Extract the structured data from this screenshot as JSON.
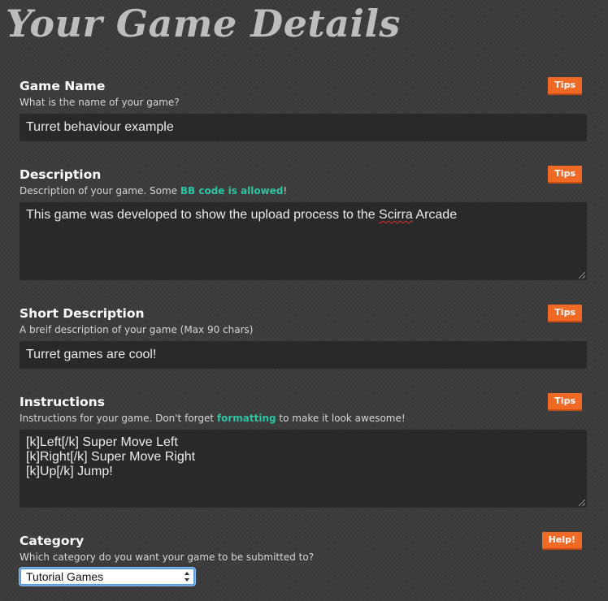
{
  "page": {
    "title": "Your Game Details"
  },
  "sections": {
    "game_name": {
      "title": "Game Name",
      "description": "What is the name of your game?",
      "tips_label": "Tips",
      "value": "Turret behaviour example"
    },
    "description": {
      "title": "Description",
      "description_before": "Description of your game. Some ",
      "description_link": "BB code is allowed",
      "description_after": "!",
      "tips_label": "Tips",
      "value_before": "This game was developed to show the upload process to the ",
      "value_misspelled": "Scirra",
      "value_after": " Arcade"
    },
    "short_description": {
      "title": "Short Description",
      "description": "A breif description of your game (Max 90 chars)",
      "tips_label": "Tips",
      "value": "Turret games are cool!"
    },
    "instructions": {
      "title": "Instructions",
      "description_before": "Instructions for your game. Don't forget ",
      "description_link": "formatting",
      "description_after": " to make it look awesome!",
      "tips_label": "Tips",
      "value": "[k]Left[/k] Super Move Left\n[k]Right[/k] Super Move Right\n[k]Up[/k] Jump!"
    },
    "category": {
      "title": "Category",
      "description": "Which category do you want your game to be submitted to?",
      "help_label": "Help!",
      "selected": "Tutorial Games"
    }
  },
  "colors": {
    "background": "#3c3c3c",
    "title": "#bdbdbd",
    "accent_button": "#f06a26",
    "link": "#2dc5a1",
    "input_bg": "#292929",
    "select_focus": "#5b9ce0"
  },
  "icons": {
    "resize": "resize-grip-icon",
    "select": "select-arrows-icon"
  }
}
